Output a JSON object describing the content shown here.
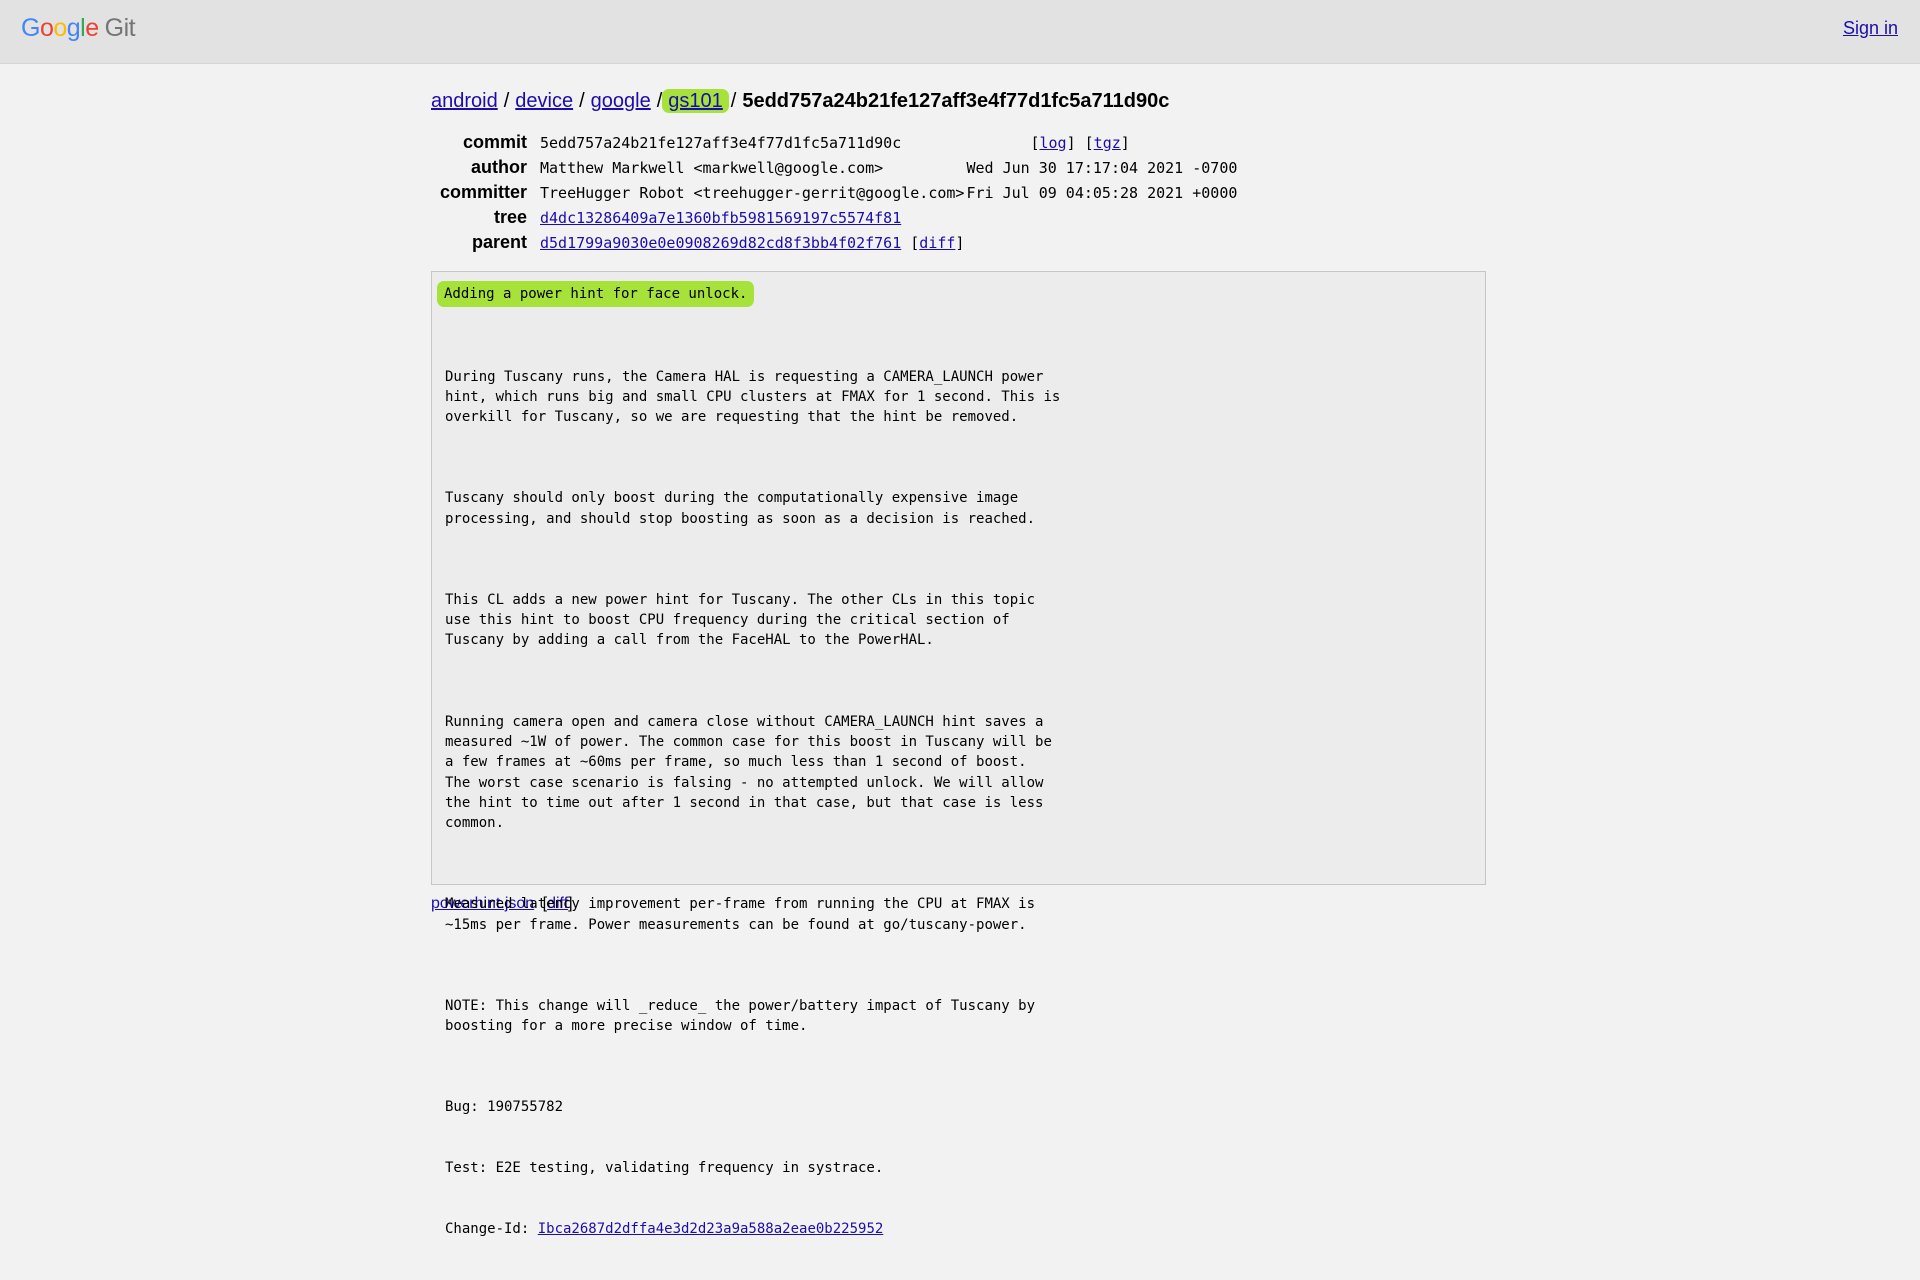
{
  "header": {
    "logo_letters": [
      "G",
      "o",
      "o",
      "g",
      "l",
      "e"
    ],
    "logo_suffix": "Git",
    "signin_label": "Sign in"
  },
  "breadcrumb": {
    "items": [
      "android",
      "device",
      "google",
      "gs101"
    ],
    "separator": "/",
    "current": "5edd757a24b21fe127aff3e4f77d1fc5a711d90c"
  },
  "meta": {
    "commit": {
      "label": "commit",
      "value": "5edd757a24b21fe127aff3e4f77d1fc5a711d90c",
      "log": "log",
      "tgz": "tgz"
    },
    "author": {
      "label": "author",
      "value": "Matthew Markwell <markwell@google.com>",
      "date": "Wed Jun 30 17:17:04 2021 -0700"
    },
    "committer": {
      "label": "committer",
      "value": "TreeHugger Robot <treehugger-gerrit@google.com>",
      "date": "Fri Jul 09 04:05:28 2021 +0000"
    },
    "tree": {
      "label": "tree",
      "value": "d4dc13286409a7e1360bfb5981569197c5574f81"
    },
    "parent": {
      "label": "parent",
      "value": "d5d1799a9030e0e0908269d82cd8f3bb4f02f761",
      "diff": "diff"
    }
  },
  "message": {
    "subject": "Adding a power hint for face unlock.",
    "paragraphs": [
      "During Tuscany runs, the Camera HAL is requesting a CAMERA_LAUNCH power\nhint, which runs big and small CPU clusters at FMAX for 1 second. This is\noverkill for Tuscany, so we are requesting that the hint be removed.",
      "Tuscany should only boost during the computationally expensive image\nprocessing, and should stop boosting as soon as a decision is reached.",
      "This CL adds a new power hint for Tuscany. The other CLs in this topic\nuse this hint to boost CPU frequency during the critical section of\nTuscany by adding a call from the FaceHAL to the PowerHAL.",
      "Running camera open and camera close without CAMERA_LAUNCH hint saves a\nmeasured ~1W of power. The common case for this boost in Tuscany will be\na few frames at ~60ms per frame, so much less than 1 second of boost.\nThe worst case scenario is falsing - no attempted unlock. We will allow\nthe hint to time out after 1 second in that case, but that case is less\ncommon.",
      "Measured latency improvement per-frame from running the CPU at FMAX is\n~15ms per frame. Power measurements can be found at go/tuscany-power.",
      "NOTE: This change will _reduce_ the power/battery impact of Tuscany by\nboosting for a more precise window of time."
    ],
    "bug": "Bug: 190755782",
    "test": "Test: E2E testing, validating frequency in systrace.",
    "change_id_label": "Change-Id: ",
    "change_id": "Ibca2687d2dffa4e3d2d23a9a588a2eae0b225952"
  },
  "files": [
    {
      "name": "powerhint.json",
      "diff": "diff"
    }
  ],
  "colors": {
    "highlight": "#a6e23a",
    "link": "#1a0dab",
    "topbar": "#e2e2e2"
  }
}
